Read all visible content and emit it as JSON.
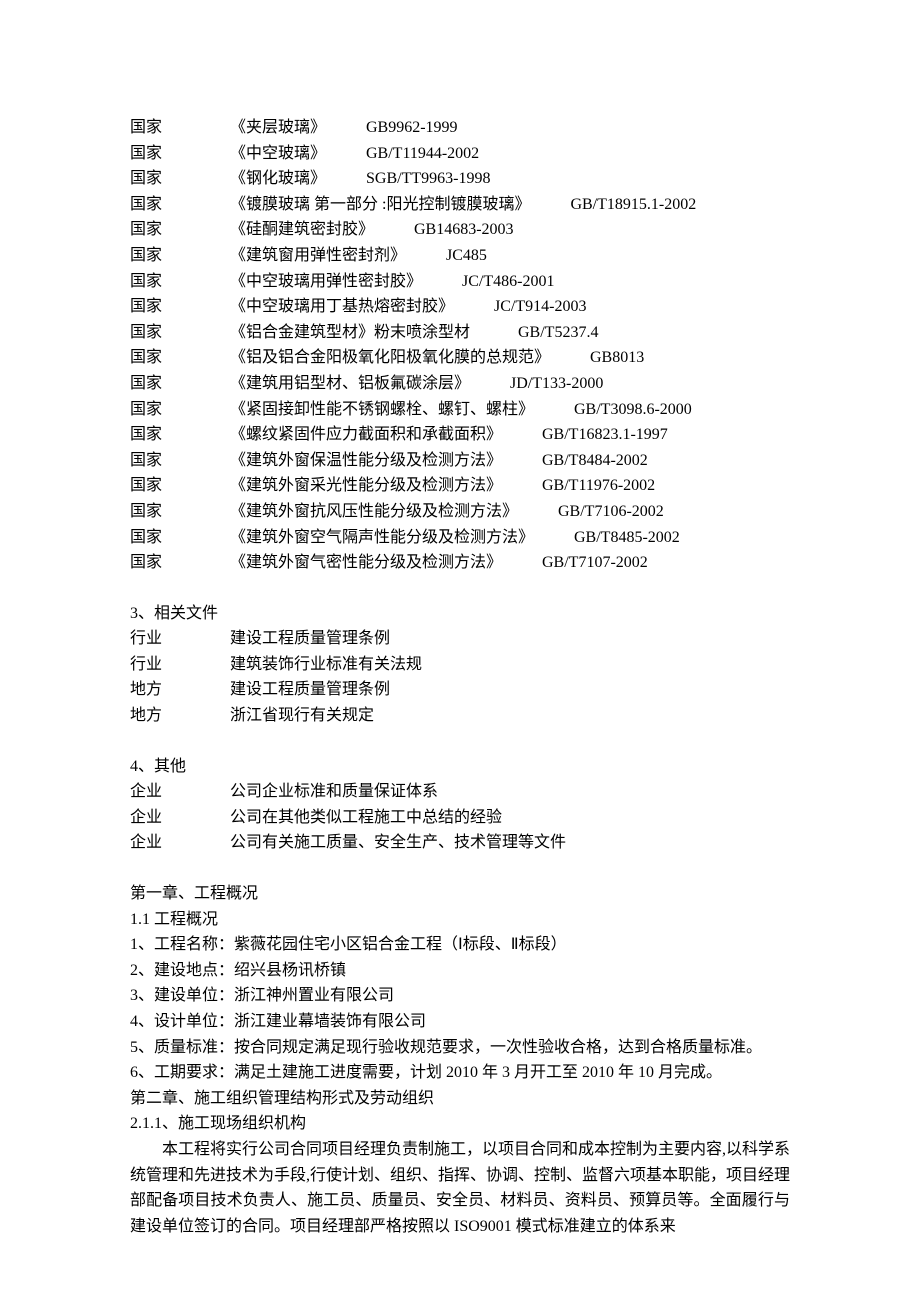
{
  "standards": [
    {
      "level": "国家",
      "title": "《夹层玻璃》",
      "code": "GB9962-1999",
      "gap1": "　　　　",
      "gap2": "　　　"
    },
    {
      "level": "国家",
      "title": "《中空玻璃》",
      "code": "GB/T11944-2002",
      "gap1": "　　　　",
      "gap2": "　　　"
    },
    {
      "level": "国家",
      "title": "《钢化玻璃》",
      "code": "SGB/TT9963-1998",
      "gap1": "　　　　",
      "gap2": "　　　"
    },
    {
      "level": "国家",
      "title": "《镀膜玻璃 第一部分 :阳光控制镀膜玻璃》",
      "code": "GB/T18915.1-2002",
      "gap1": "　　　　",
      "gap2": "　　　"
    },
    {
      "level": "国家",
      "title": "《硅酮建筑密封胶》",
      "code": "GB14683-2003",
      "gap1": "　　　　",
      "gap2": "　　　"
    },
    {
      "level": "国家",
      "title": "《建筑窗用弹性密封剂》",
      "code": "JC485",
      "gap1": "　　　　",
      "gap2": "　　　"
    },
    {
      "level": "国家",
      "title": "《中空玻璃用弹性密封胶》",
      "code": "JC/T486-2001",
      "gap1": "　　　　",
      "gap2": "　　　"
    },
    {
      "level": "国家",
      "title": "《中空玻璃用丁基热熔密封胶》",
      "code": "JC/T914-2003",
      "gap1": "　　　　",
      "gap2": "　　　"
    },
    {
      "level": "国家",
      "title": "《铝合金建筑型材》粉末喷涂型材",
      "code": "GB/T5237.4",
      "gap1": "　　　　",
      "gap2": "　　　"
    },
    {
      "level": "国家",
      "title": "《铝及铝合金阳极氧化阳极氧化膜的总规范》",
      "code": "GB8013",
      "gap1": "　　　　",
      "gap2": "　　　"
    },
    {
      "level": "国家",
      "title": "《建筑用铝型材、铝板氟碳涂层》",
      "code": "JD/T133-2000",
      "gap1": "　　　　",
      "gap2": "　　　"
    },
    {
      "level": "国家",
      "title": "《紧固接卸性能不锈钢螺栓、螺钉、螺柱》",
      "code": "GB/T3098.6-2000",
      "gap1": "　　　　",
      "gap2": "　　　"
    },
    {
      "level": "国家",
      "title": "《螺纹紧固件应力截面积和承截面积》",
      "code": "GB/T16823.1-1997",
      "gap1": "　　　　",
      "gap2": "　　　"
    },
    {
      "level": "国家",
      "title": "《建筑外窗保温性能分级及检测方法》",
      "code": "GB/T8484-2002",
      "gap1": "　　　　",
      "gap2": "　　　"
    },
    {
      "level": "国家",
      "title": "《建筑外窗采光性能分级及检测方法》",
      "code": "GB/T11976-2002",
      "gap1": "　　　　",
      "gap2": "　　　"
    },
    {
      "level": "国家",
      "title": "《建筑外窗抗风压性能分级及检测方法》",
      "code": "GB/T7106-2002",
      "gap1": "　　　　",
      "gap2": "　　　"
    },
    {
      "level": "国家",
      "title": "《建筑外窗空气隔声性能分级及检测方法》",
      "code": "GB/T8485-2002",
      "gap1": "　　　　",
      "gap2": "　　　"
    },
    {
      "level": "国家",
      "title": "《建筑外窗气密性能分级及检测方法》",
      "code": "GB/T7107-2002",
      "gap1": "　　　　",
      "gap2": "　　　"
    }
  ],
  "section3": {
    "heading": "3、相关文件",
    "items": [
      {
        "level": "行业",
        "text": "建设工程质量管理条例"
      },
      {
        "level": "行业",
        "text": "建筑装饰行业标准有关法规"
      },
      {
        "level": "地方",
        "text": "建设工程质量管理条例"
      },
      {
        "level": "地方",
        "text": "浙江省现行有关规定"
      }
    ]
  },
  "section4": {
    "heading": "4、其他",
    "items": [
      {
        "level": "企业",
        "text": "公司企业标准和质量保证体系"
      },
      {
        "level": "企业",
        "text": "公司在其他类似工程施工中总结的经验"
      },
      {
        "level": "企业",
        "text": "公司有关施工质量、安全生产、技术管理等文件"
      }
    ]
  },
  "chapter1": {
    "heading": "第一章、工程概况",
    "sub": "1.1 工程概况",
    "items": [
      "1、工程名称：紫薇花园住宅小区铝合金工程（Ⅰ标段、Ⅱ标段）",
      "2、建设地点：绍兴县杨讯桥镇",
      "3、建设单位：浙江神州置业有限公司",
      "4、设计单位：浙江建业幕墙装饰有限公司",
      "5、质量标准：按合同规定满足现行验收规范要求，一次性验收合格，达到合格质量标准。",
      "6、工期要求：满足土建施工进度需要，计划 2010 年 3 月开工至 2010 年 10 月完成。"
    ]
  },
  "chapter2": {
    "heading": "第二章、施工组织管理结构形式及劳动组织",
    "sub": "2.1.1、施工现场组织机构",
    "para": "本工程将实行公司合同项目经理负责制施工，以项目合同和成本控制为主要内容,以科学系统管理和先进技术为手段,行使计划、组织、指挥、协调、控制、监督六项基本职能，项目经理部配备项目技术负责人、施工员、质量员、安全员、材料员、资料员、预算员等。全面履行与建设单位签订的合同。项目经理部严格按照以 ISO9001 模式标准建立的体系来"
  }
}
